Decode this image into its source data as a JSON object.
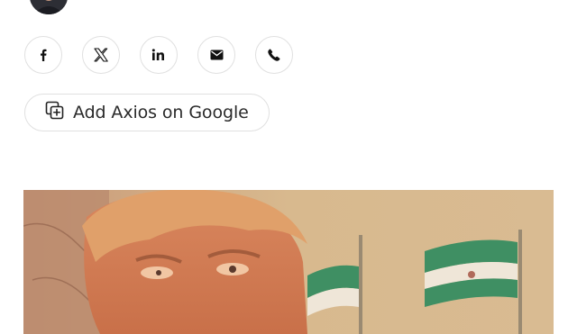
{
  "author": {
    "avatar_icon": "author-avatar"
  },
  "share": {
    "buttons": [
      {
        "network": "facebook",
        "icon": "facebook-icon"
      },
      {
        "network": "x",
        "icon": "x-icon"
      },
      {
        "network": "linkedin",
        "icon": "linkedin-icon"
      },
      {
        "network": "email",
        "icon": "mail-icon"
      },
      {
        "network": "phone",
        "icon": "phone-icon"
      }
    ]
  },
  "google_button": {
    "label": "Add Axios on Google",
    "icon": "add-source-icon"
  },
  "hero_image": {
    "flag_color_top": "#3f8f63",
    "flag_color_bottom": "#3f8f63",
    "background_color": "#d8b98e"
  }
}
